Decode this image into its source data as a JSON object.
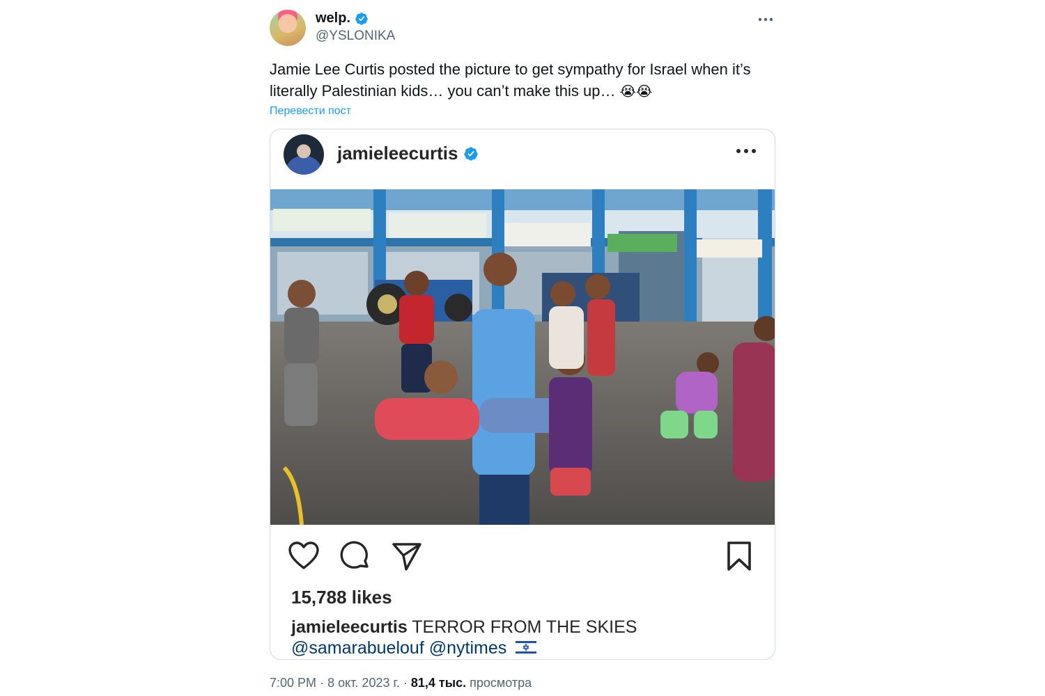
{
  "author": {
    "display_name": "welp.",
    "handle": "@YSLONIKA",
    "verified": true
  },
  "tweet": {
    "text_line1": "Jamie Lee Curtis posted the picture to get sympathy for Israel when it’s",
    "text_line2": "literally Palestinian kids… you can’t make this up…",
    "emojis": "😭😭",
    "translate_label": "Перевести пост"
  },
  "embed": {
    "username": "jamieleecurtis",
    "verified": true,
    "likes": "15,788 likes",
    "caption_user": "jamieleecurtis",
    "caption_text": "TERROR FROM THE SKIES",
    "mention1": "@samarabuelouf",
    "mention2": "@nytimes"
  },
  "meta": {
    "time": "7:00 PM",
    "date": "8 окт. 2023 г.",
    "views_count": "81,4 тыс.",
    "views_label": "просмотра",
    "separator": "·"
  },
  "colors": {
    "verified_blue": "#1d9bf0",
    "link_blue": "#1d9bf0",
    "muted": "#536471",
    "border": "#cfd9de"
  },
  "icons": [
    "verified-badge-icon",
    "more-icon",
    "heart-icon",
    "comment-icon",
    "share-icon",
    "bookmark-icon",
    "israel-flag-icon"
  ]
}
